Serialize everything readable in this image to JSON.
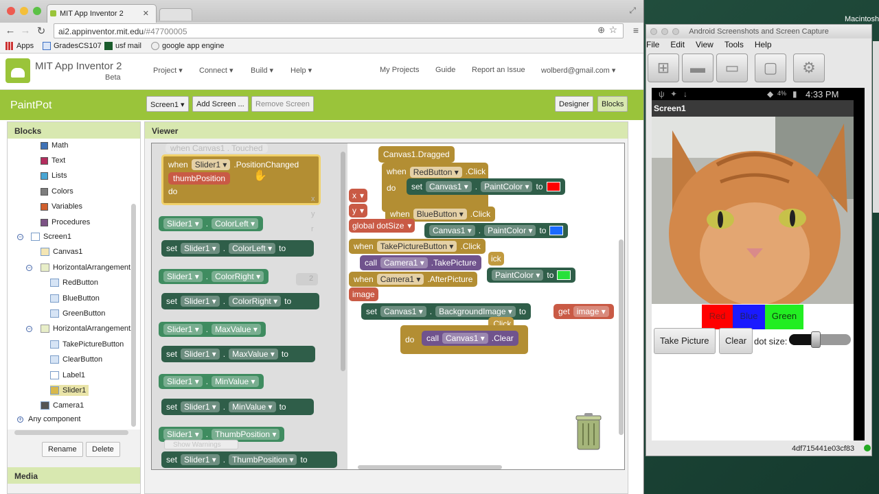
{
  "browser": {
    "tab_title": "MIT App Inventor 2",
    "url_host": "ai2.appinventor.mit.edu",
    "url_path": "/#47700005",
    "bookmarks": [
      "Apps",
      "GradesCS107",
      "usf mail",
      "google app engine"
    ]
  },
  "header": {
    "title": "MIT App Inventor 2",
    "subtitle": "Beta",
    "menus": [
      "Project",
      "Connect",
      "Build",
      "Help"
    ],
    "links": [
      "My Projects",
      "Guide",
      "Report an Issue"
    ],
    "user": "wolberd@gmail.com"
  },
  "project_bar": {
    "name": "PaintPot",
    "screen": "Screen1",
    "add_screen": "Add Screen ...",
    "remove_screen": "Remove Screen",
    "designer": "Designer",
    "blocks": "Blocks"
  },
  "blocks_panel": {
    "title": "Blocks",
    "builtin": [
      {
        "label": "Math",
        "color": "#3f71b5"
      },
      {
        "label": "Text",
        "color": "#b32d5e"
      },
      {
        "label": "Lists",
        "color": "#49a6d4"
      },
      {
        "label": "Colors",
        "color": "#7d7d7d"
      },
      {
        "label": "Variables",
        "color": "#d05f2d"
      },
      {
        "label": "Procedures",
        "color": "#7c5385"
      }
    ],
    "components": [
      "Screen1",
      "Canvas1",
      "HorizontalArrangement1",
      "RedButton",
      "BlueButton",
      "GreenButton",
      "HorizontalArrangement2",
      "TakePictureButton",
      "ClearButton",
      "Label1",
      "Slider1",
      "Camera1"
    ],
    "any_component": "Any component",
    "rename": "Rename",
    "delete": "Delete",
    "media": "Media"
  },
  "viewer": {
    "title": "Viewer",
    "flyout": {
      "faded_event": "when Canvas1 . Touched",
      "event_when": "when",
      "event_component": "Slider1",
      "event_name": ".PositionChanged",
      "event_param": "thumbPosition",
      "event_do": "do",
      "faded_params": [
        "x",
        "y",
        "r"
      ],
      "getters": [
        {
          "comp": "Slider1",
          "prop": "ColorLeft"
        },
        {
          "comp": "Slider1",
          "prop": "ColorRight"
        },
        {
          "comp": "Slider1",
          "prop": "MaxValue"
        },
        {
          "comp": "Slider1",
          "prop": "MinValue"
        },
        {
          "comp": "Slider1",
          "prop": "ThumbPosition"
        }
      ],
      "setters": [
        {
          "comp": "Slider1",
          "prop": "ColorLeft"
        },
        {
          "comp": "Slider1",
          "prop": "ColorRight"
        },
        {
          "comp": "Slider1",
          "prop": "MaxValue"
        },
        {
          "comp": "Slider1",
          "prop": "MinValue"
        },
        {
          "comp": "Slider1",
          "prop": "ThumbPosition"
        }
      ],
      "set_kw": "set",
      "dot": ".",
      "to_kw": "to",
      "faded_num": "2",
      "show_warnings": "Show Warnings"
    },
    "workspace": {
      "canvas_dragged": "Canvas1.Dragged",
      "red_click_comp": "RedButton",
      "blue_click_comp": "BlueButton",
      "click": ".Click",
      "canvas": "Canvas1",
      "paint_color": "PaintColor",
      "param_x": "x",
      "param_y": "y",
      "global_dotsize": "global dotSize",
      "take_picture_btn": "TakePictureButton",
      "call_kw": "call",
      "camera": "Camera1",
      "take_picture": ".TakePicture",
      "after_picture": ".AfterPicture",
      "image": "image",
      "background_image": "BackgroundImage",
      "get_kw": "get",
      "clear": ".Clear",
      "hidden_frag1": "ick",
      "hidden_frag2": "when",
      "hidden_frag3": "do",
      "colors": {
        "red": "#ff0000",
        "blue": "#1a6aff",
        "green": "#27e03a"
      }
    }
  },
  "emulator": {
    "window_title": "Android Screenshots and Screen Capture",
    "menu": [
      "File",
      "Edit",
      "View",
      "Tools",
      "Help"
    ],
    "status_time": "4:33 PM",
    "battery": "4%",
    "screen_title": "Screen1",
    "buttons": [
      {
        "label": "Red",
        "bg": "#ff0000",
        "fg": "#8c1616"
      },
      {
        "label": "Blue",
        "bg": "#1a1aff",
        "fg": "#1f1f6a"
      },
      {
        "label": "Green",
        "bg": "#22ee22",
        "fg": "#0e3a0e"
      }
    ],
    "take_picture": "Take Picture",
    "clear": "Clear",
    "dot_size": "dot size:",
    "device_id": "4df715441e03cf83"
  },
  "desktop": {
    "mac_label": "Macintosh"
  }
}
